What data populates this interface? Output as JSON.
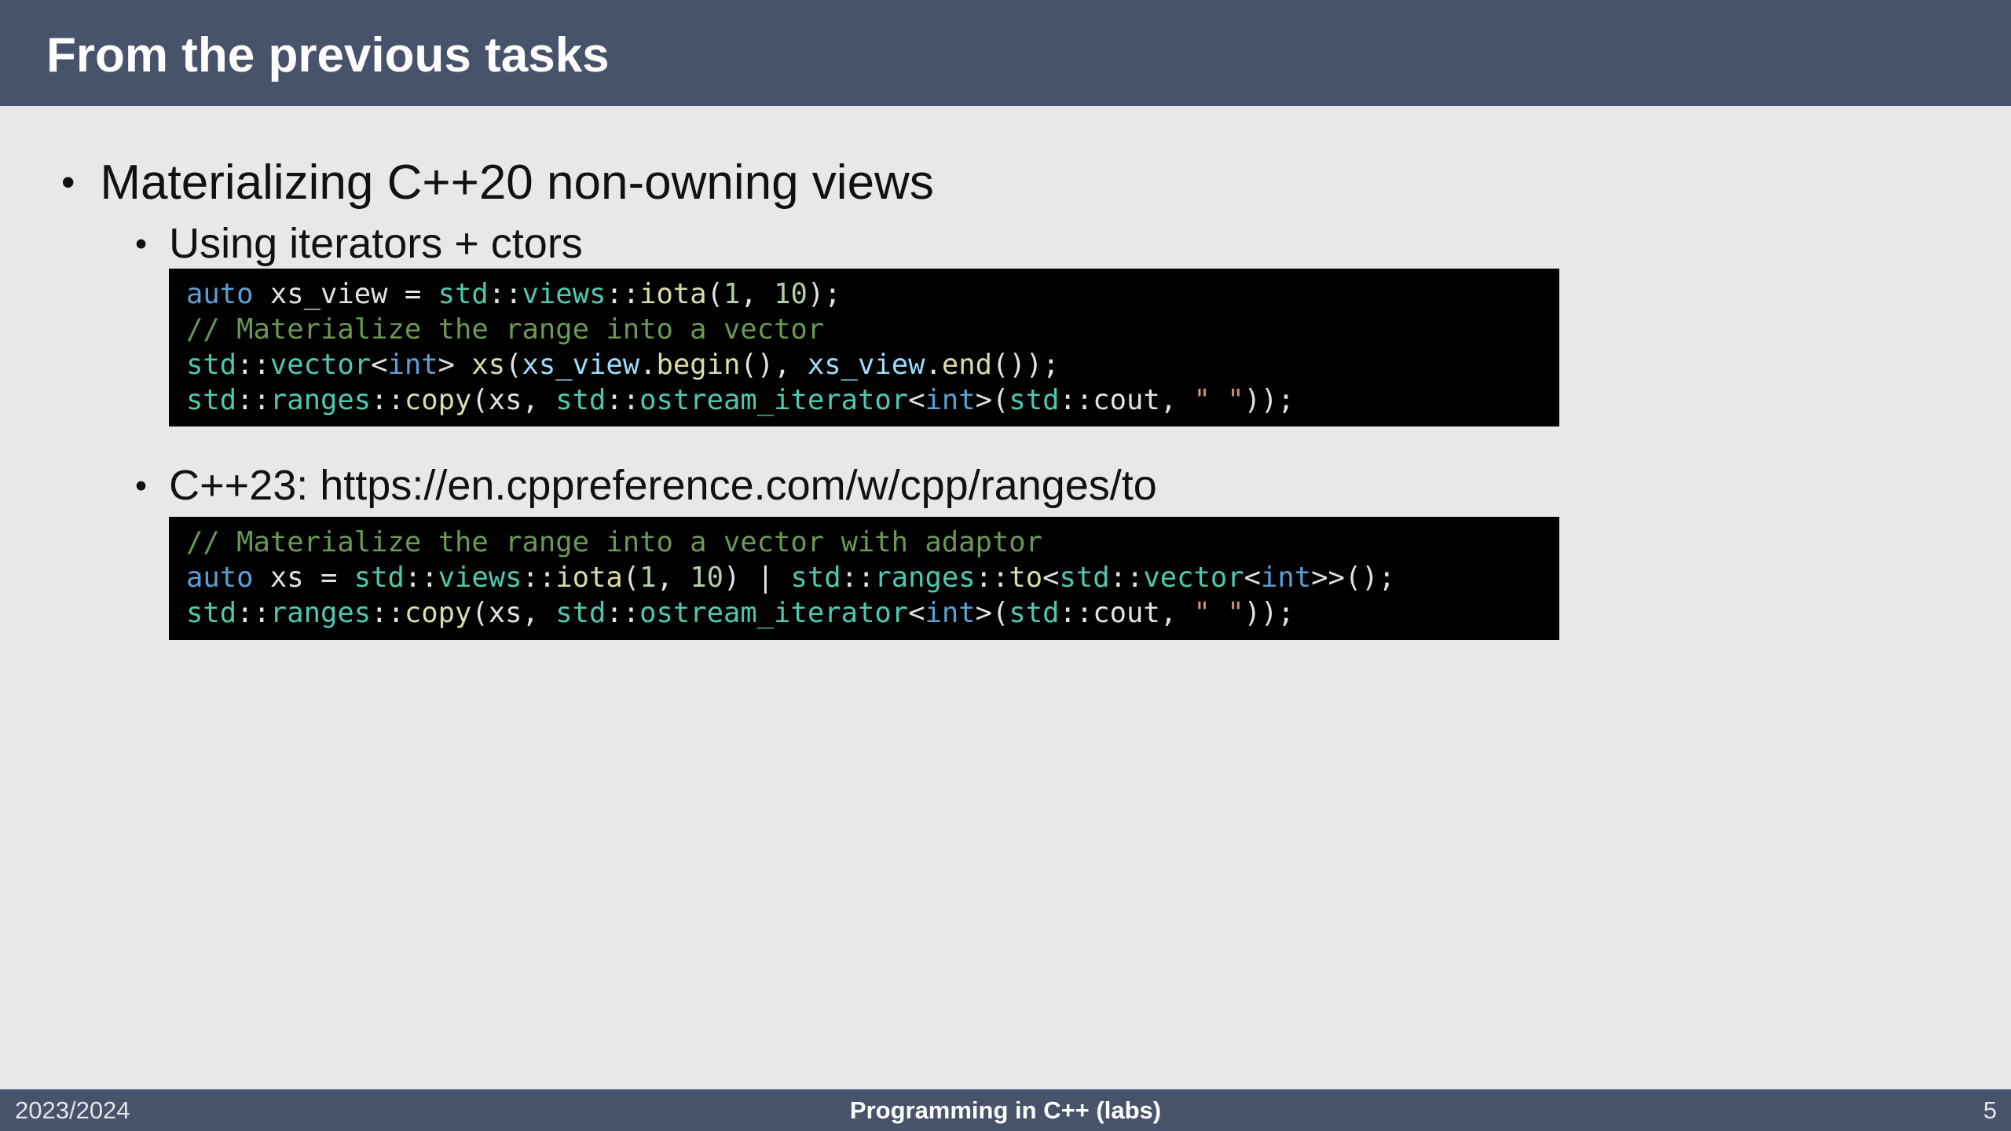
{
  "header": {
    "title": "From the previous tasks"
  },
  "content": {
    "bullet_main": "Materializing C++20 non-owning views",
    "bullet_dot": "•",
    "sub_bullets": [
      {
        "label": "Using iterators + ctors"
      },
      {
        "label": "C++23: https://en.cppreference.com/w/cpp/ranges/to"
      }
    ]
  },
  "code_blocks": [
    {
      "lines": [
        [
          {
            "t": "auto",
            "k": "keyword"
          },
          {
            "t": " xs_view = ",
            "k": "plain"
          },
          {
            "t": "std",
            "k": "ns"
          },
          {
            "t": "::",
            "k": "plain"
          },
          {
            "t": "views",
            "k": "ns"
          },
          {
            "t": "::",
            "k": "plain"
          },
          {
            "t": "iota",
            "k": "func"
          },
          {
            "t": "(",
            "k": "plain"
          },
          {
            "t": "1",
            "k": "num"
          },
          {
            "t": ", ",
            "k": "plain"
          },
          {
            "t": "10",
            "k": "num"
          },
          {
            "t": ");",
            "k": "plain"
          }
        ],
        [
          {
            "t": "// Materialize the range into a vector",
            "k": "comment"
          }
        ],
        [
          {
            "t": "std",
            "k": "ns"
          },
          {
            "t": "::",
            "k": "plain"
          },
          {
            "t": "vector",
            "k": "ns"
          },
          {
            "t": "<",
            "k": "plain"
          },
          {
            "t": "int",
            "k": "keyword"
          },
          {
            "t": "> ",
            "k": "plain"
          },
          {
            "t": "xs",
            "k": "func"
          },
          {
            "t": "(",
            "k": "plain"
          },
          {
            "t": "xs_view",
            "k": "var"
          },
          {
            "t": ".",
            "k": "plain"
          },
          {
            "t": "begin",
            "k": "func"
          },
          {
            "t": "(), ",
            "k": "plain"
          },
          {
            "t": "xs_view",
            "k": "var"
          },
          {
            "t": ".",
            "k": "plain"
          },
          {
            "t": "end",
            "k": "func"
          },
          {
            "t": "());",
            "k": "plain"
          }
        ],
        [
          {
            "t": "std",
            "k": "ns"
          },
          {
            "t": "::",
            "k": "plain"
          },
          {
            "t": "ranges",
            "k": "ns"
          },
          {
            "t": "::",
            "k": "plain"
          },
          {
            "t": "copy",
            "k": "func"
          },
          {
            "t": "(xs, ",
            "k": "plain"
          },
          {
            "t": "std",
            "k": "ns"
          },
          {
            "t": "::",
            "k": "plain"
          },
          {
            "t": "ostream_iterator",
            "k": "ns"
          },
          {
            "t": "<",
            "k": "plain"
          },
          {
            "t": "int",
            "k": "keyword"
          },
          {
            "t": ">(",
            "k": "plain"
          },
          {
            "t": "std",
            "k": "ns"
          },
          {
            "t": "::",
            "k": "plain"
          },
          {
            "t": "cout",
            "k": "plain"
          },
          {
            "t": ", ",
            "k": "plain"
          },
          {
            "t": "\" \"",
            "k": "str"
          },
          {
            "t": "));",
            "k": "plain"
          }
        ]
      ]
    },
    {
      "lines": [
        [
          {
            "t": "// Materialize the range into a vector with adaptor",
            "k": "comment"
          }
        ],
        [
          {
            "t": "auto",
            "k": "keyword"
          },
          {
            "t": " xs = ",
            "k": "plain"
          },
          {
            "t": "std",
            "k": "ns"
          },
          {
            "t": "::",
            "k": "plain"
          },
          {
            "t": "views",
            "k": "ns"
          },
          {
            "t": "::",
            "k": "plain"
          },
          {
            "t": "iota",
            "k": "func"
          },
          {
            "t": "(",
            "k": "plain"
          },
          {
            "t": "1",
            "k": "num"
          },
          {
            "t": ", ",
            "k": "plain"
          },
          {
            "t": "10",
            "k": "num"
          },
          {
            "t": ") | ",
            "k": "plain"
          },
          {
            "t": "std",
            "k": "ns"
          },
          {
            "t": "::",
            "k": "plain"
          },
          {
            "t": "ranges",
            "k": "ns"
          },
          {
            "t": "::",
            "k": "plain"
          },
          {
            "t": "to",
            "k": "func"
          },
          {
            "t": "<",
            "k": "plain"
          },
          {
            "t": "std",
            "k": "ns"
          },
          {
            "t": "::",
            "k": "plain"
          },
          {
            "t": "vector",
            "k": "ns"
          },
          {
            "t": "<",
            "k": "plain"
          },
          {
            "t": "int",
            "k": "keyword"
          },
          {
            "t": ">>();",
            "k": "plain"
          }
        ],
        [
          {
            "t": "std",
            "k": "ns"
          },
          {
            "t": "::",
            "k": "plain"
          },
          {
            "t": "ranges",
            "k": "ns"
          },
          {
            "t": "::",
            "k": "plain"
          },
          {
            "t": "copy",
            "k": "func"
          },
          {
            "t": "(xs, ",
            "k": "plain"
          },
          {
            "t": "std",
            "k": "ns"
          },
          {
            "t": "::",
            "k": "plain"
          },
          {
            "t": "ostream_iterator",
            "k": "ns"
          },
          {
            "t": "<",
            "k": "plain"
          },
          {
            "t": "int",
            "k": "keyword"
          },
          {
            "t": ">(",
            "k": "plain"
          },
          {
            "t": "std",
            "k": "ns"
          },
          {
            "t": "::",
            "k": "plain"
          },
          {
            "t": "cout",
            "k": "plain"
          },
          {
            "t": ", ",
            "k": "plain"
          },
          {
            "t": "\" \"",
            "k": "str"
          },
          {
            "t": "));",
            "k": "plain"
          }
        ]
      ]
    }
  ],
  "footer": {
    "left": "2023/2024",
    "center": "Programming in C++ (labs)",
    "page_number": "5"
  },
  "colors": {
    "header_bg": "#46536b",
    "slide_bg": "#e8e8e8",
    "code_bg": "#000000",
    "keyword": "#5a9fd6",
    "comment": "#6a9955",
    "namespace": "#4ec9b0",
    "function": "#dcdcaa"
  }
}
